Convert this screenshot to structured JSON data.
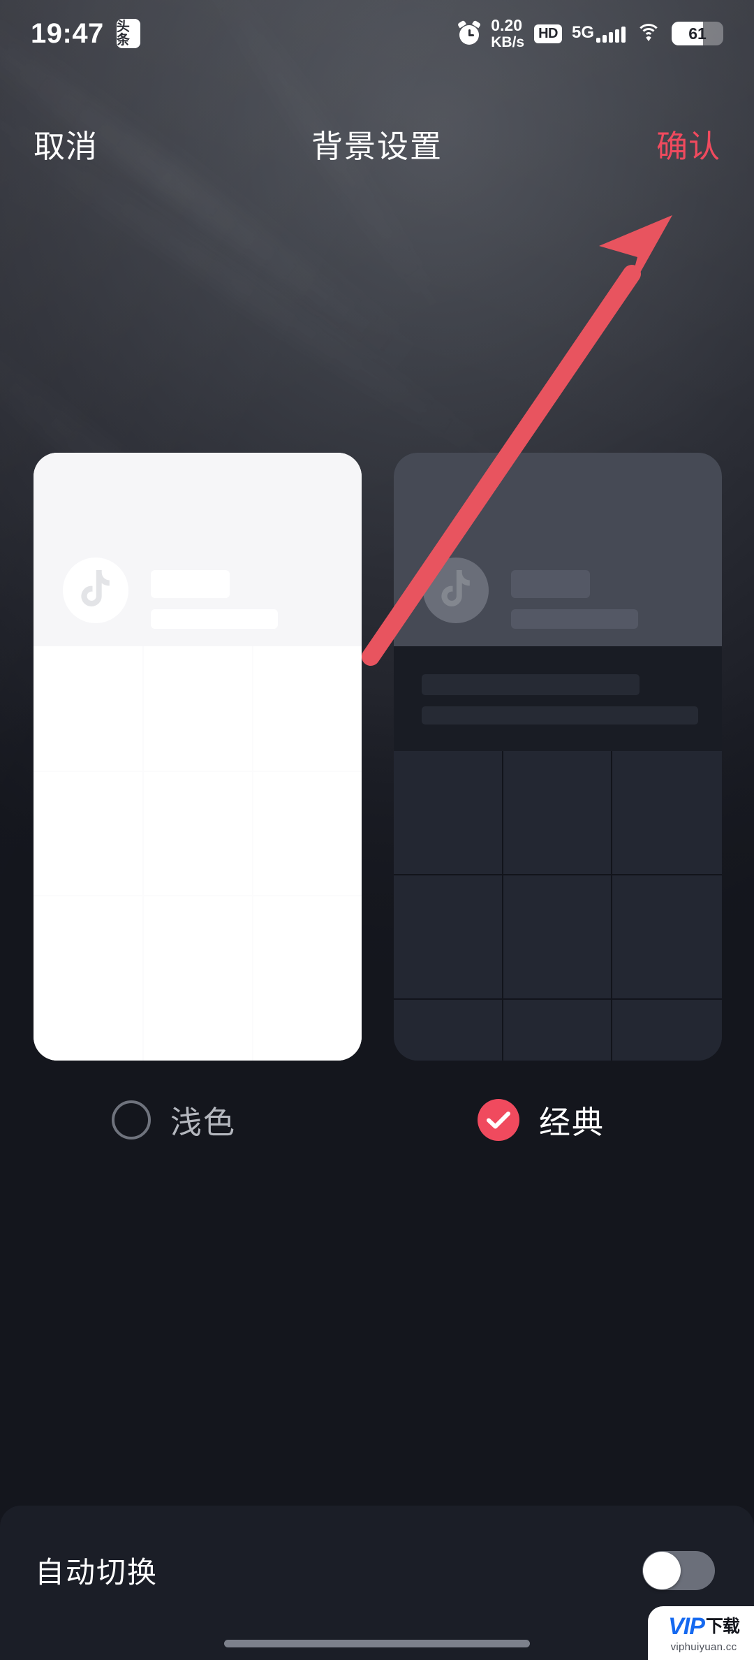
{
  "status_bar": {
    "time": "19:47",
    "app_badge": "头条",
    "alarm_icon": "alarm-clock-icon",
    "network_speed_value": "0.20",
    "network_speed_unit": "KB/s",
    "hd_badge": "HD",
    "network_type": "5G",
    "signal_bars": 5,
    "wifi_icon": "wifi-icon",
    "battery_percent": "61"
  },
  "nav": {
    "cancel_label": "取消",
    "title": "背景设置",
    "confirm_label": "确认",
    "confirm_color": "#f04a5e"
  },
  "previews": [
    {
      "key": "light",
      "name": "light-theme-preview",
      "avatar_icon": "tiktok-note-icon"
    },
    {
      "key": "classic",
      "name": "classic-theme-preview",
      "avatar_icon": "tiktok-note-icon",
      "grid_cells": 9
    }
  ],
  "options": [
    {
      "label": "浅色",
      "selected": false,
      "name": "theme-option-light"
    },
    {
      "label": "经典",
      "selected": true,
      "name": "theme-option-classic",
      "accent": "#f04a5e"
    }
  ],
  "bottom": {
    "auto_switch_label": "自动切换",
    "auto_switch_on": false
  },
  "annotation": {
    "type": "arrow",
    "color": "#e8545f",
    "points_to": "确认"
  },
  "watermark": {
    "brand": "VIP",
    "brand_cn": "下载",
    "url": "viphuiyuan.cc"
  }
}
